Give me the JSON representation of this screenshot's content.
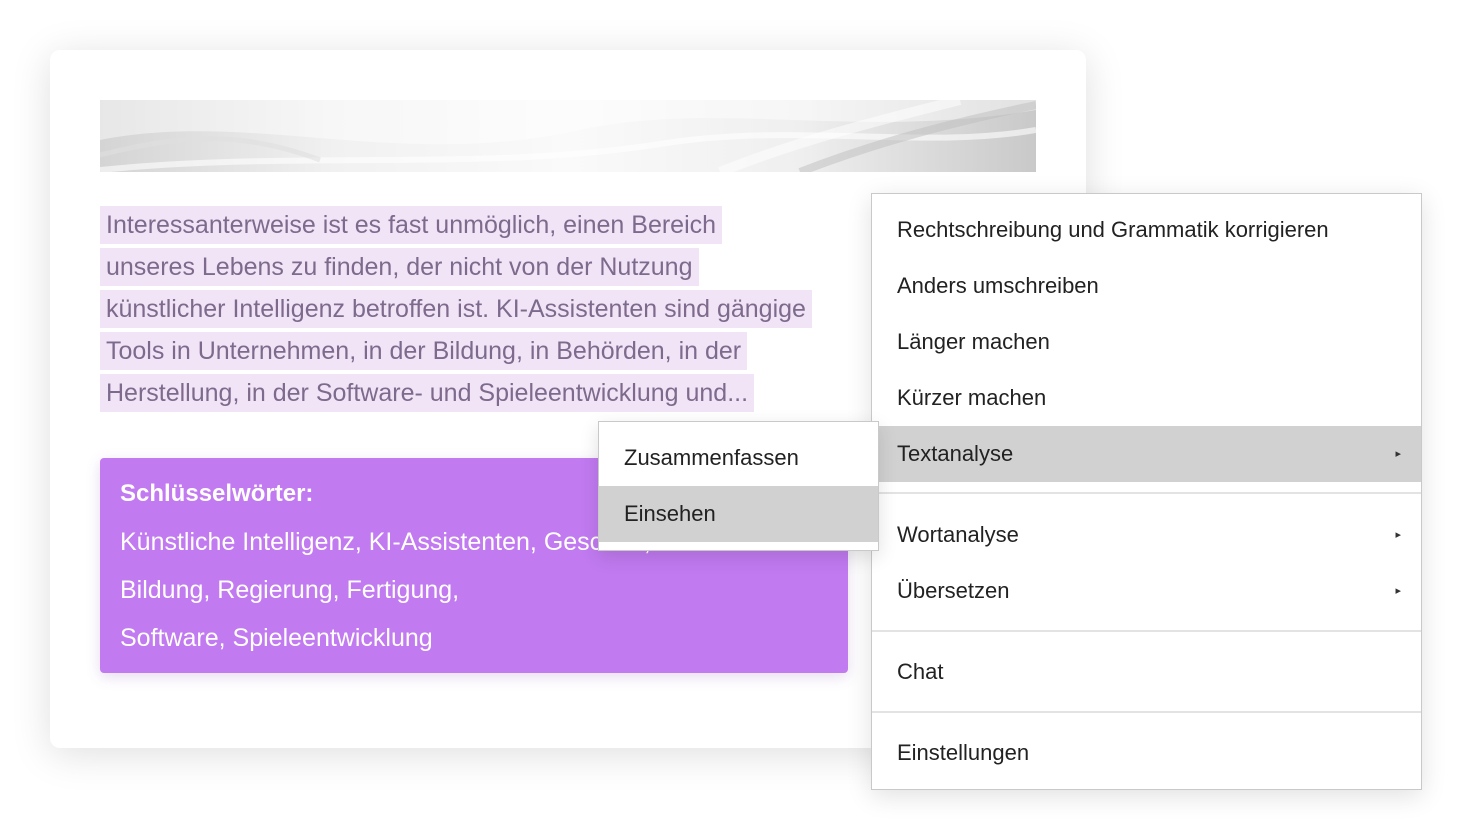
{
  "paragraph_lines": [
    "Interessanterweise ist es fast unmöglich, einen Bereich",
    "unseres Lebens zu finden, der nicht von der Nutzung",
    "künstlicher Intelligenz betroffen ist. KI-Assistenten sind gängige",
    "Tools in Unternehmen, in der Bildung, in Behörden, in der",
    "Herstellung, in der Software- und Spieleentwicklung und..."
  ],
  "keywords": {
    "title": "Schlüsselwörter:",
    "lines": [
      "Künstliche Intelligenz, KI-Assistenten, Geschäft,",
      "Bildung, Regierung, Fertigung,",
      "Software, Spieleentwicklung"
    ]
  },
  "context_menu": {
    "items": [
      {
        "label": "Rechtschreibung und Grammatik korrigieren"
      },
      {
        "label": "Anders umschreiben"
      },
      {
        "label": "Länger machen"
      },
      {
        "label": "Kürzer machen"
      },
      {
        "label": "Textanalyse",
        "submenu": true,
        "active": true
      },
      {
        "label": "Wortanalyse",
        "submenu": true
      },
      {
        "label": "Übersetzen",
        "submenu": true
      },
      {
        "label": "Chat"
      },
      {
        "label": "Einstellungen"
      }
    ],
    "arrow_glyph": "▸"
  },
  "submenu": {
    "items": [
      {
        "label": "Zusammenfassen"
      },
      {
        "label": "Einsehen",
        "active": true
      }
    ]
  },
  "colors": {
    "highlight": "#f2e4f7",
    "keyword_box": "#c17af0",
    "menu_active": "#d1d1d1"
  }
}
